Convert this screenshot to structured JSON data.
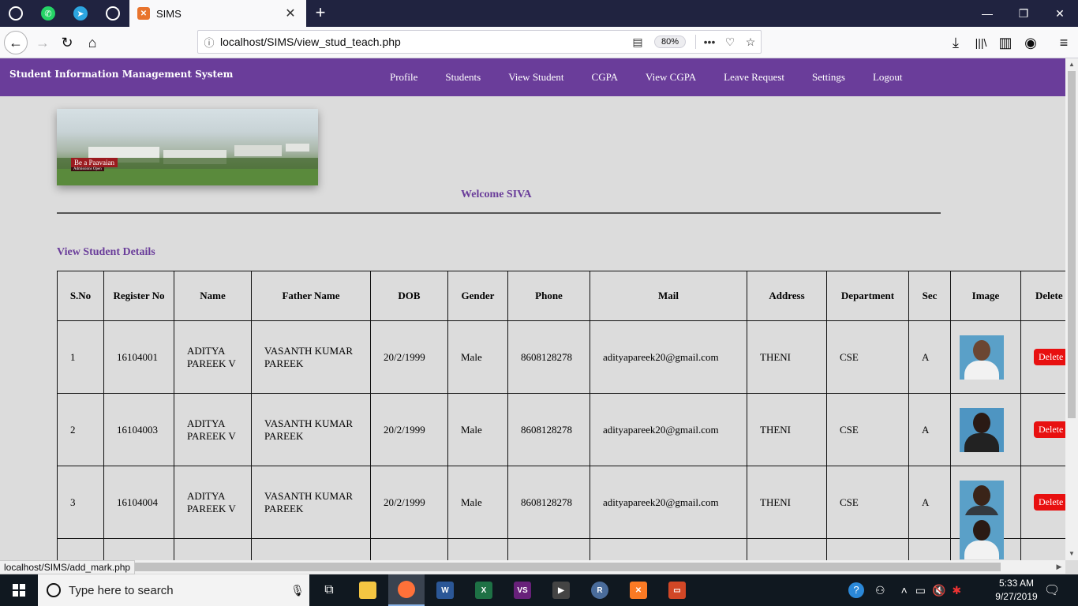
{
  "browser": {
    "tab_title": "SIMS",
    "url": "localhost/SIMS/view_stud_teach.php",
    "zoom": "80%",
    "status_url": "localhost/SIMS/add_mark.php"
  },
  "header": {
    "brand": "Student Information Management System",
    "menu": [
      "Profile",
      "Students",
      "View Student",
      "CGPA",
      "View CGPA",
      "Leave Request",
      "Settings",
      "Logout"
    ]
  },
  "banner": {
    "tag": "Be a Paavaian",
    "sub": "Admissions Open"
  },
  "welcome": "Welcome SIVA",
  "section_title": "View Student Details",
  "table": {
    "headers": [
      "S.No",
      "Register No",
      "Name",
      "Father Name",
      "DOB",
      "Gender",
      "Phone",
      "Mail",
      "Address",
      "Department",
      "Sec",
      "Image",
      "Delete"
    ],
    "rows": [
      {
        "sno": "1",
        "reg": "16104001",
        "name": "ADITYA PAREEK V",
        "father": "VASANTH KUMAR PAREEK",
        "dob": "20/2/1999",
        "gender": "Male",
        "phone": "8608128278",
        "mail": "adityapareek20@gmail.com",
        "address": "THENI",
        "dept": "CSE",
        "sec": "A",
        "delete": "Delete"
      },
      {
        "sno": "2",
        "reg": "16104003",
        "name": "ADITYA PAREEK V",
        "father": "VASANTH KUMAR PAREEK",
        "dob": "20/2/1999",
        "gender": "Male",
        "phone": "8608128278",
        "mail": "adityapareek20@gmail.com",
        "address": "THENI",
        "dept": "CSE",
        "sec": "A",
        "delete": "Delete"
      },
      {
        "sno": "3",
        "reg": "16104004",
        "name": "ADITYA PAREEK V",
        "father": "VASANTH KUMAR PAREEK",
        "dob": "20/2/1999",
        "gender": "Male",
        "phone": "8608128278",
        "mail": "adityapareek20@gmail.com",
        "address": "THENI",
        "dept": "CSE",
        "sec": "A",
        "delete": "Delete"
      }
    ]
  },
  "taskbar": {
    "search_placeholder": "Type here to search",
    "time": "5:33 AM",
    "date": "9/27/2019"
  }
}
